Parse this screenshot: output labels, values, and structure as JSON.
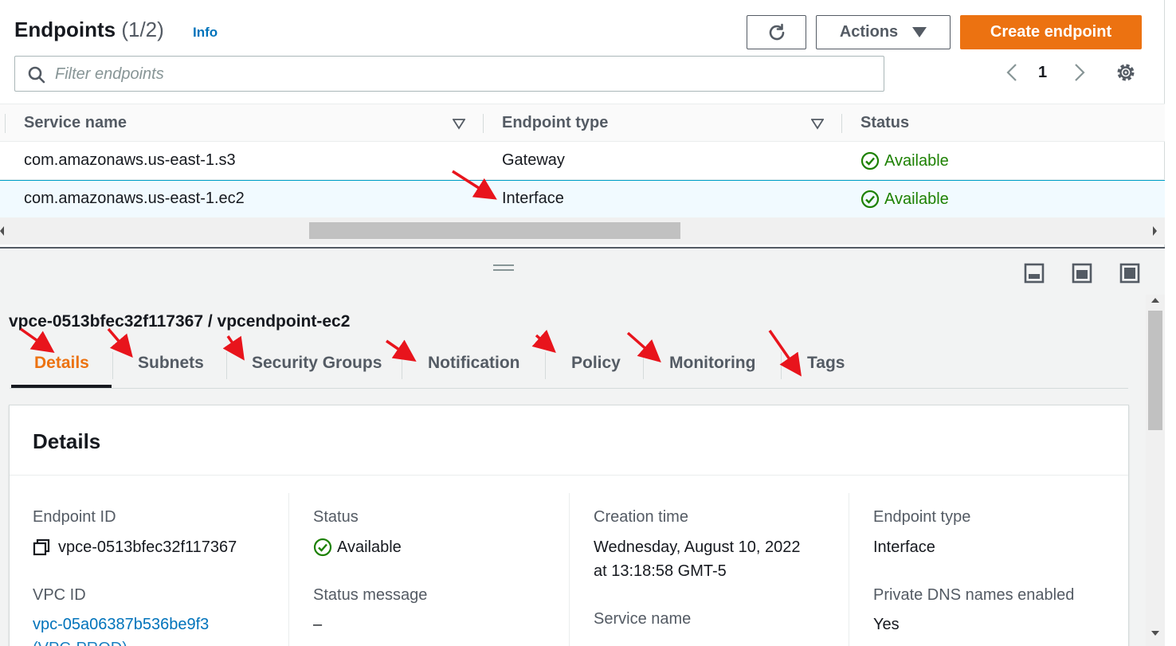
{
  "header": {
    "title": "Endpoints",
    "count": "(1/2)",
    "info": "Info",
    "actions_label": "Actions",
    "create_label": "Create endpoint"
  },
  "search": {
    "placeholder": "Filter endpoints"
  },
  "pagination": {
    "current_page": "1"
  },
  "table": {
    "columns": [
      "Service name",
      "Endpoint type",
      "Status"
    ],
    "rows": [
      {
        "service": "com.amazonaws.us-east-1.s3",
        "type": "Gateway",
        "status": "Available"
      },
      {
        "service": "com.amazonaws.us-east-1.ec2",
        "type": "Interface",
        "status": "Available",
        "selected": true
      }
    ]
  },
  "detail": {
    "title": "vpce-0513bfec32f117367 / vpcendpoint-ec2",
    "tabs": [
      "Details",
      "Subnets",
      "Security Groups",
      "Notification",
      "Policy",
      "Monitoring",
      "Tags"
    ],
    "active_tab": "Details",
    "card_title": "Details",
    "fields": {
      "endpoint_id_label": "Endpoint ID",
      "endpoint_id": "vpce-0513bfec32f117367",
      "vpc_id_label": "VPC ID",
      "vpc_id": "vpc-05a06387b536be9f3",
      "status_label": "Status",
      "status": "Available",
      "status_message_label": "Status message",
      "status_message": "–",
      "creation_time_label": "Creation time",
      "creation_time_line1": "Wednesday, August 10, 2022",
      "creation_time_line2": "at 13:18:58 GMT-5",
      "service_name_label": "Service name",
      "endpoint_type_label": "Endpoint type",
      "endpoint_type": "Interface",
      "private_dns_label": "Private DNS names enabled",
      "private_dns": "Yes"
    }
  },
  "colors": {
    "primary_button": "#ec7211",
    "link": "#0073bb",
    "success": "#1d8102",
    "selected_row": "#f1faff",
    "annotation_arrow": "#e8141c"
  },
  "icons": [
    "refresh-icon",
    "caret-down-icon",
    "search-icon",
    "chevron-left-icon",
    "chevron-right-icon",
    "gear-icon",
    "sort-icon",
    "check-circle-icon",
    "copy-icon",
    "drag-handle-icon",
    "panel-bottom-icon",
    "panel-side-icon",
    "panel-full-icon",
    "annotation-arrow"
  ]
}
